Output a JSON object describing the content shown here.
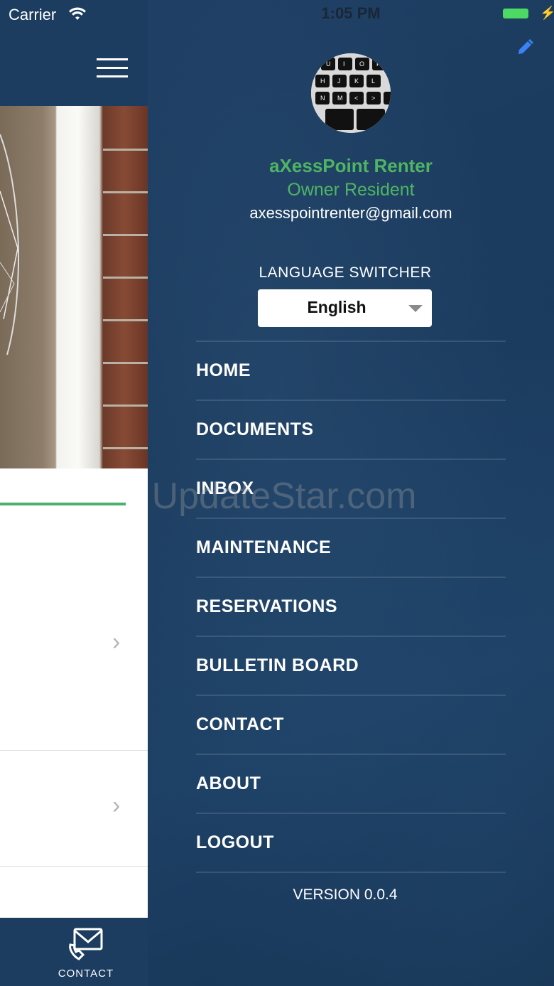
{
  "status_bar": {
    "carrier": "Carrier",
    "time": "1:05 PM"
  },
  "left_screen": {
    "tab_label": "CONTACT"
  },
  "drawer": {
    "user_name": "aXessPoint Renter",
    "user_role": "Owner Resident",
    "user_email": "axesspointrenter@gmail.com",
    "language_label": "LANGUAGE SWITCHER",
    "language_value": "English",
    "menu_items": [
      {
        "label": "HOME"
      },
      {
        "label": "DOCUMENTS"
      },
      {
        "label": "INBOX"
      },
      {
        "label": "MAINTENANCE"
      },
      {
        "label": "RESERVATIONS"
      },
      {
        "label": "BULLETIN BOARD"
      },
      {
        "label": "CONTACT"
      },
      {
        "label": "ABOUT"
      },
      {
        "label": "LOGOUT"
      }
    ],
    "version": "VERSION 0.0.4"
  },
  "watermark": "UpdateStar.com",
  "colors": {
    "header_blue": "#1c3d5f",
    "accent_green": "#4fb463",
    "edit_blue": "#3b82f6"
  },
  "icons": [
    "wifi-icon",
    "hamburger-menu-icon",
    "chevron-right-icon",
    "contact-envelope-icon",
    "edit-pencil-icon",
    "dropdown-caret-icon",
    "battery-icon"
  ]
}
